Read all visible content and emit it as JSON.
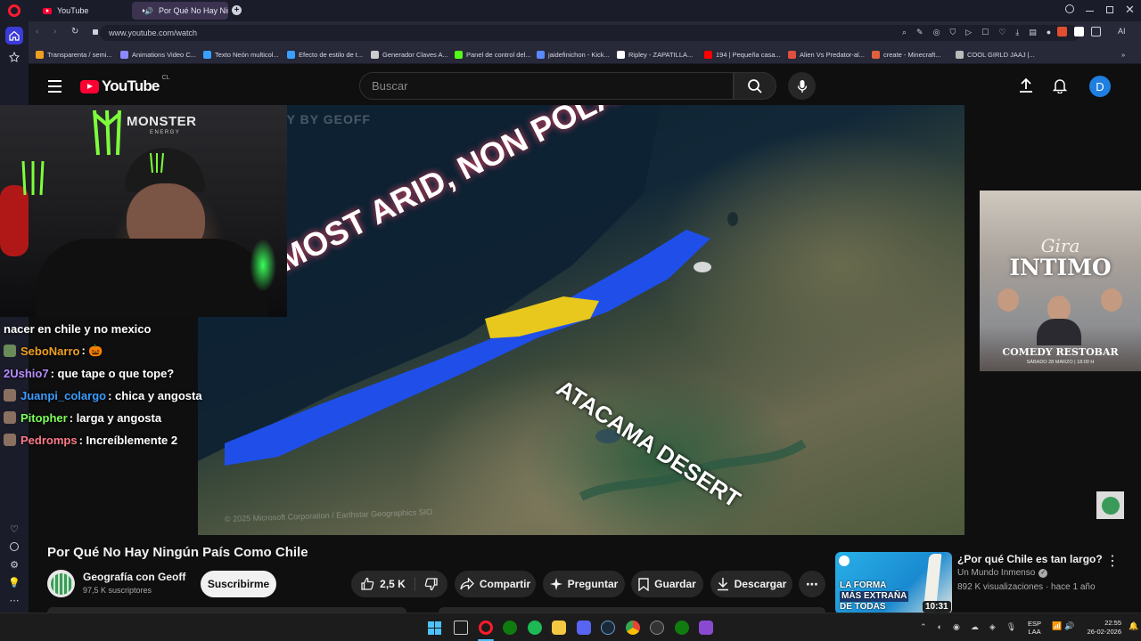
{
  "browser": {
    "tabs": [
      {
        "label": "YouTube"
      },
      {
        "label": "Por Qué No Hay Ningún País Como Chile"
      }
    ],
    "url": "www.youtube.com/watch",
    "ai_label": "AI"
  },
  "bookmarks": [
    {
      "label": "Transparenta / semi...",
      "color": "#f0a020"
    },
    {
      "label": "Animations Video C...",
      "color": "#8a8aff"
    },
    {
      "label": "Texto Neón multicol...",
      "color": "#3aa0ff"
    },
    {
      "label": "Efecto de estilo de t...",
      "color": "#3aa0ff"
    },
    {
      "label": "Generador Claves A...",
      "color": "#cccccc"
    },
    {
      "label": "Panel de control del...",
      "color": "#53fc18"
    },
    {
      "label": "jaidefinichon - Kick...",
      "color": "#5a8aff"
    },
    {
      "label": "Ripley - ZAPATILLA...",
      "color": "#ffffff"
    },
    {
      "label": "194 | Pequeña casa...",
      "color": "#ff0000"
    },
    {
      "label": "Alien Vs Predator-al...",
      "color": "#e05040"
    },
    {
      "label": "create - Minecraft...",
      "color": "#e06040"
    },
    {
      "label": "COOL GIRLD JAAJ |...",
      "color": "#bbbbbb"
    }
  ],
  "youtube": {
    "logo_text": "YouTube",
    "country_code": "CL",
    "search_placeholder": "Buscar",
    "avatar_letter": "D",
    "accent": "#ff0033"
  },
  "video": {
    "overlay_title": "MOST ARID, NON POLAR PLACE",
    "overlay_region": "ATACAMA DESERT",
    "watermark": "GEOGRAPHY BY GEOFF",
    "credit": "© 2025 Microsoft Corporation / Earthstar Geographics SIO",
    "sponsor": "MONSTER",
    "sponsor_sub": "ENERGY"
  },
  "chat": [
    {
      "user": "",
      "message": "nacer en chile y no mexico",
      "user_color": "#ffffff"
    },
    {
      "user": "SeboNarro",
      "message": ": 🎃",
      "user_color": "#f0a020"
    },
    {
      "user": "2Ushio7",
      "message": ": que tape o que tope?",
      "user_color": "#b58cff"
    },
    {
      "user": "Juanpi_colargo",
      "message": ": chica y angosta",
      "user_color": "#3a9cff"
    },
    {
      "user": "Pitopher",
      "message": ": larga y angosta",
      "user_color": "#7cff5a"
    },
    {
      "user": "Pedromps",
      "message": ": Increíblemente 2",
      "user_color": "#ff7a8a"
    }
  ],
  "poster": {
    "line1": "Gira",
    "line2": "INTIMO",
    "venue": "COMEDY RESTOBAR",
    "date": "SÁBADO 28 MARZO | 18:00 H"
  },
  "video_info": {
    "title": "Por Qué No Hay Ningún País Como Chile",
    "channel": "Geografía con Geoff",
    "subscribers": "97,5 K suscriptores",
    "subscribe_label": "Suscribirme",
    "likes": "2,5 K",
    "share": "Compartir",
    "ask": "Preguntar",
    "save": "Guardar",
    "download": "Descargar"
  },
  "recommended": {
    "title": "¿Por qué Chile es tan largo?",
    "channel": "Un Mundo Inmenso",
    "stats": "892 K visualizaciones · hace 1 año",
    "duration": "10:31",
    "thumb_text_1": "LA FORMA",
    "thumb_text_2": "MÁS EXTRAÑA",
    "thumb_text_3": "DE TODAS"
  },
  "taskbar": {
    "lang": "ESP",
    "lang_sub": "LAA",
    "time": "22:55",
    "date": "26-02-2026"
  }
}
